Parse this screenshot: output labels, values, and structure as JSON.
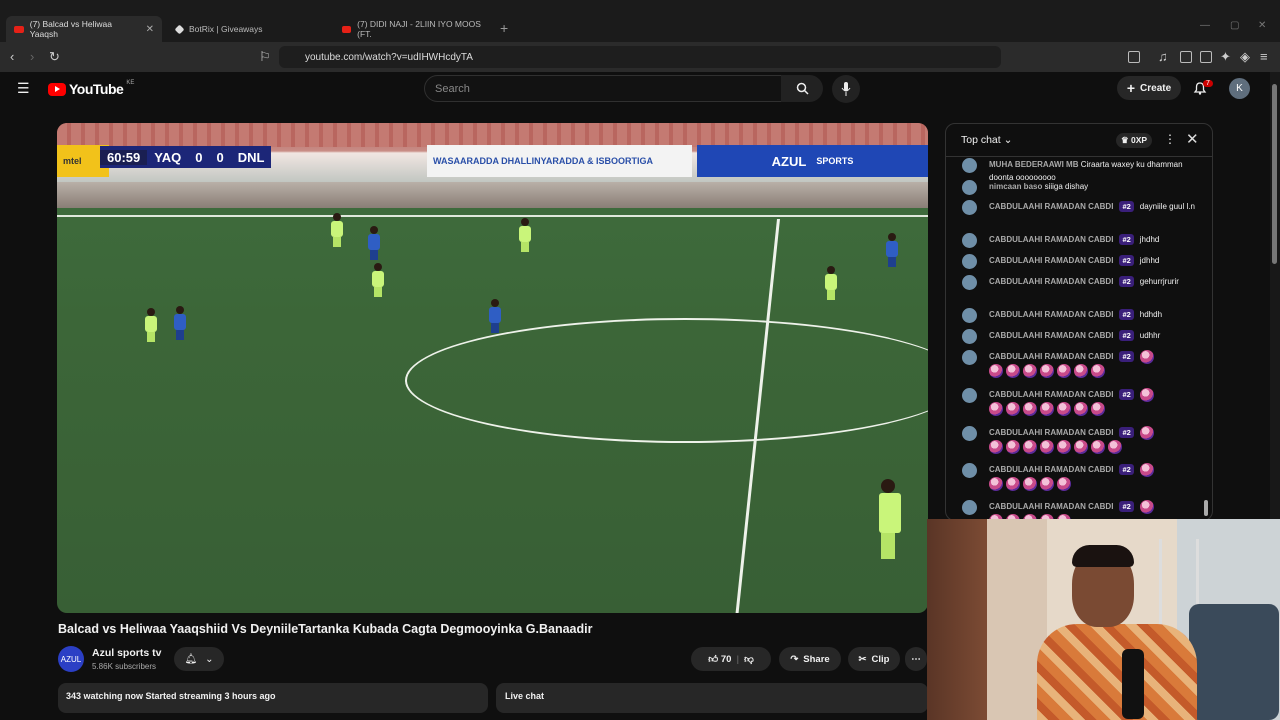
{
  "browser": {
    "tabs": [
      {
        "label": "(7) Balcad vs Heliwaa Yaaqsh",
        "active": true
      },
      {
        "label": "BotRix | Giveaways",
        "active": false
      },
      {
        "label": "(7) DIDI NAJI - 2LIIN IYO MOOS (FT.",
        "active": false
      }
    ],
    "new_tab": "+",
    "url": "youtube.com/watch?v=udIHWHcdyTA"
  },
  "youtube": {
    "logo_word": "YouTube",
    "country_code": "KE",
    "search_placeholder": "Search",
    "create_label": "Create",
    "notification_count": "7",
    "avatar_letter": "K"
  },
  "video": {
    "scoreboard": {
      "time": "60:59",
      "home": "YAQ",
      "home_score": "0",
      "away_score": "0",
      "away": "DNL"
    },
    "ads": [
      "mtel",
      "WASAARADDA DHALLINYARADDA & ISBOORTIGA",
      "AZUL",
      "SPORTS"
    ],
    "title": "Balcad vs Heliwaa Yaaqshiid Vs DeyniileTartanka Kubada Cagta Degmooyinka G.Banaadir",
    "channel_name": "Azul sports tv",
    "subscribers": "5.86K subscribers",
    "channel_avatar": "AZUL",
    "likes": "70",
    "share_label": "Share",
    "clip_label": "Clip",
    "meta": "343 watching now  Started streaming 3 hours ago",
    "live_chat_label": "Live chat"
  },
  "chat": {
    "header": "Top chat",
    "xp": "0XP",
    "messages": [
      {
        "author": "MUHA BEDERAAWI MB",
        "badge": "",
        "text": "Ciraarta waxey ku dhamman doonta ooooooooo",
        "emotes": 0
      },
      {
        "author": "nimcaan baso",
        "badge": "",
        "text": "siiiga dishay",
        "emotes": 0
      },
      {
        "author": "CABDULAAHI RAMADAN CABDI",
        "badge": "#2",
        "text": "dayniile guul l.n",
        "emotes": 0
      },
      {
        "author": "CABDULAAHI RAMADAN CABDI",
        "badge": "#2",
        "text": "jhdhd",
        "emotes": 0
      },
      {
        "author": "CABDULAAHI RAMADAN CABDI",
        "badge": "#2",
        "text": "jdhhd",
        "emotes": 0
      },
      {
        "author": "CABDULAAHI RAMADAN CABDI",
        "badge": "#2",
        "text": "gehurrjrurir",
        "emotes": 0
      },
      {
        "author": "CABDULAAHI RAMADAN CABDI",
        "badge": "#2",
        "text": "hdhdh",
        "emotes": 0
      },
      {
        "author": "CABDULAAHI RAMADAN CABDI",
        "badge": "#2",
        "text": "udhhr",
        "emotes": 0
      },
      {
        "author": "CABDULAAHI RAMADAN CABDI",
        "badge": "#2",
        "text": "",
        "emotes": 7
      },
      {
        "author": "CABDULAAHI RAMADAN CABDI",
        "badge": "#2",
        "text": "",
        "emotes": 7
      },
      {
        "author": "CABDULAAHI RAMADAN CABDI",
        "badge": "#2",
        "text": "",
        "emotes": 8
      },
      {
        "author": "CABDULAAHI RAMADAN CABDI",
        "badge": "#2",
        "text": "",
        "emotes": 5
      },
      {
        "author": "CABDULAAHI RAMADAN CABDI",
        "badge": "#2",
        "text": "",
        "emotes": 5
      }
    ]
  },
  "colors": {
    "background": "#0f0f0f",
    "brand_red": "#ff0000",
    "badge_purple": "#3a1f7a"
  }
}
